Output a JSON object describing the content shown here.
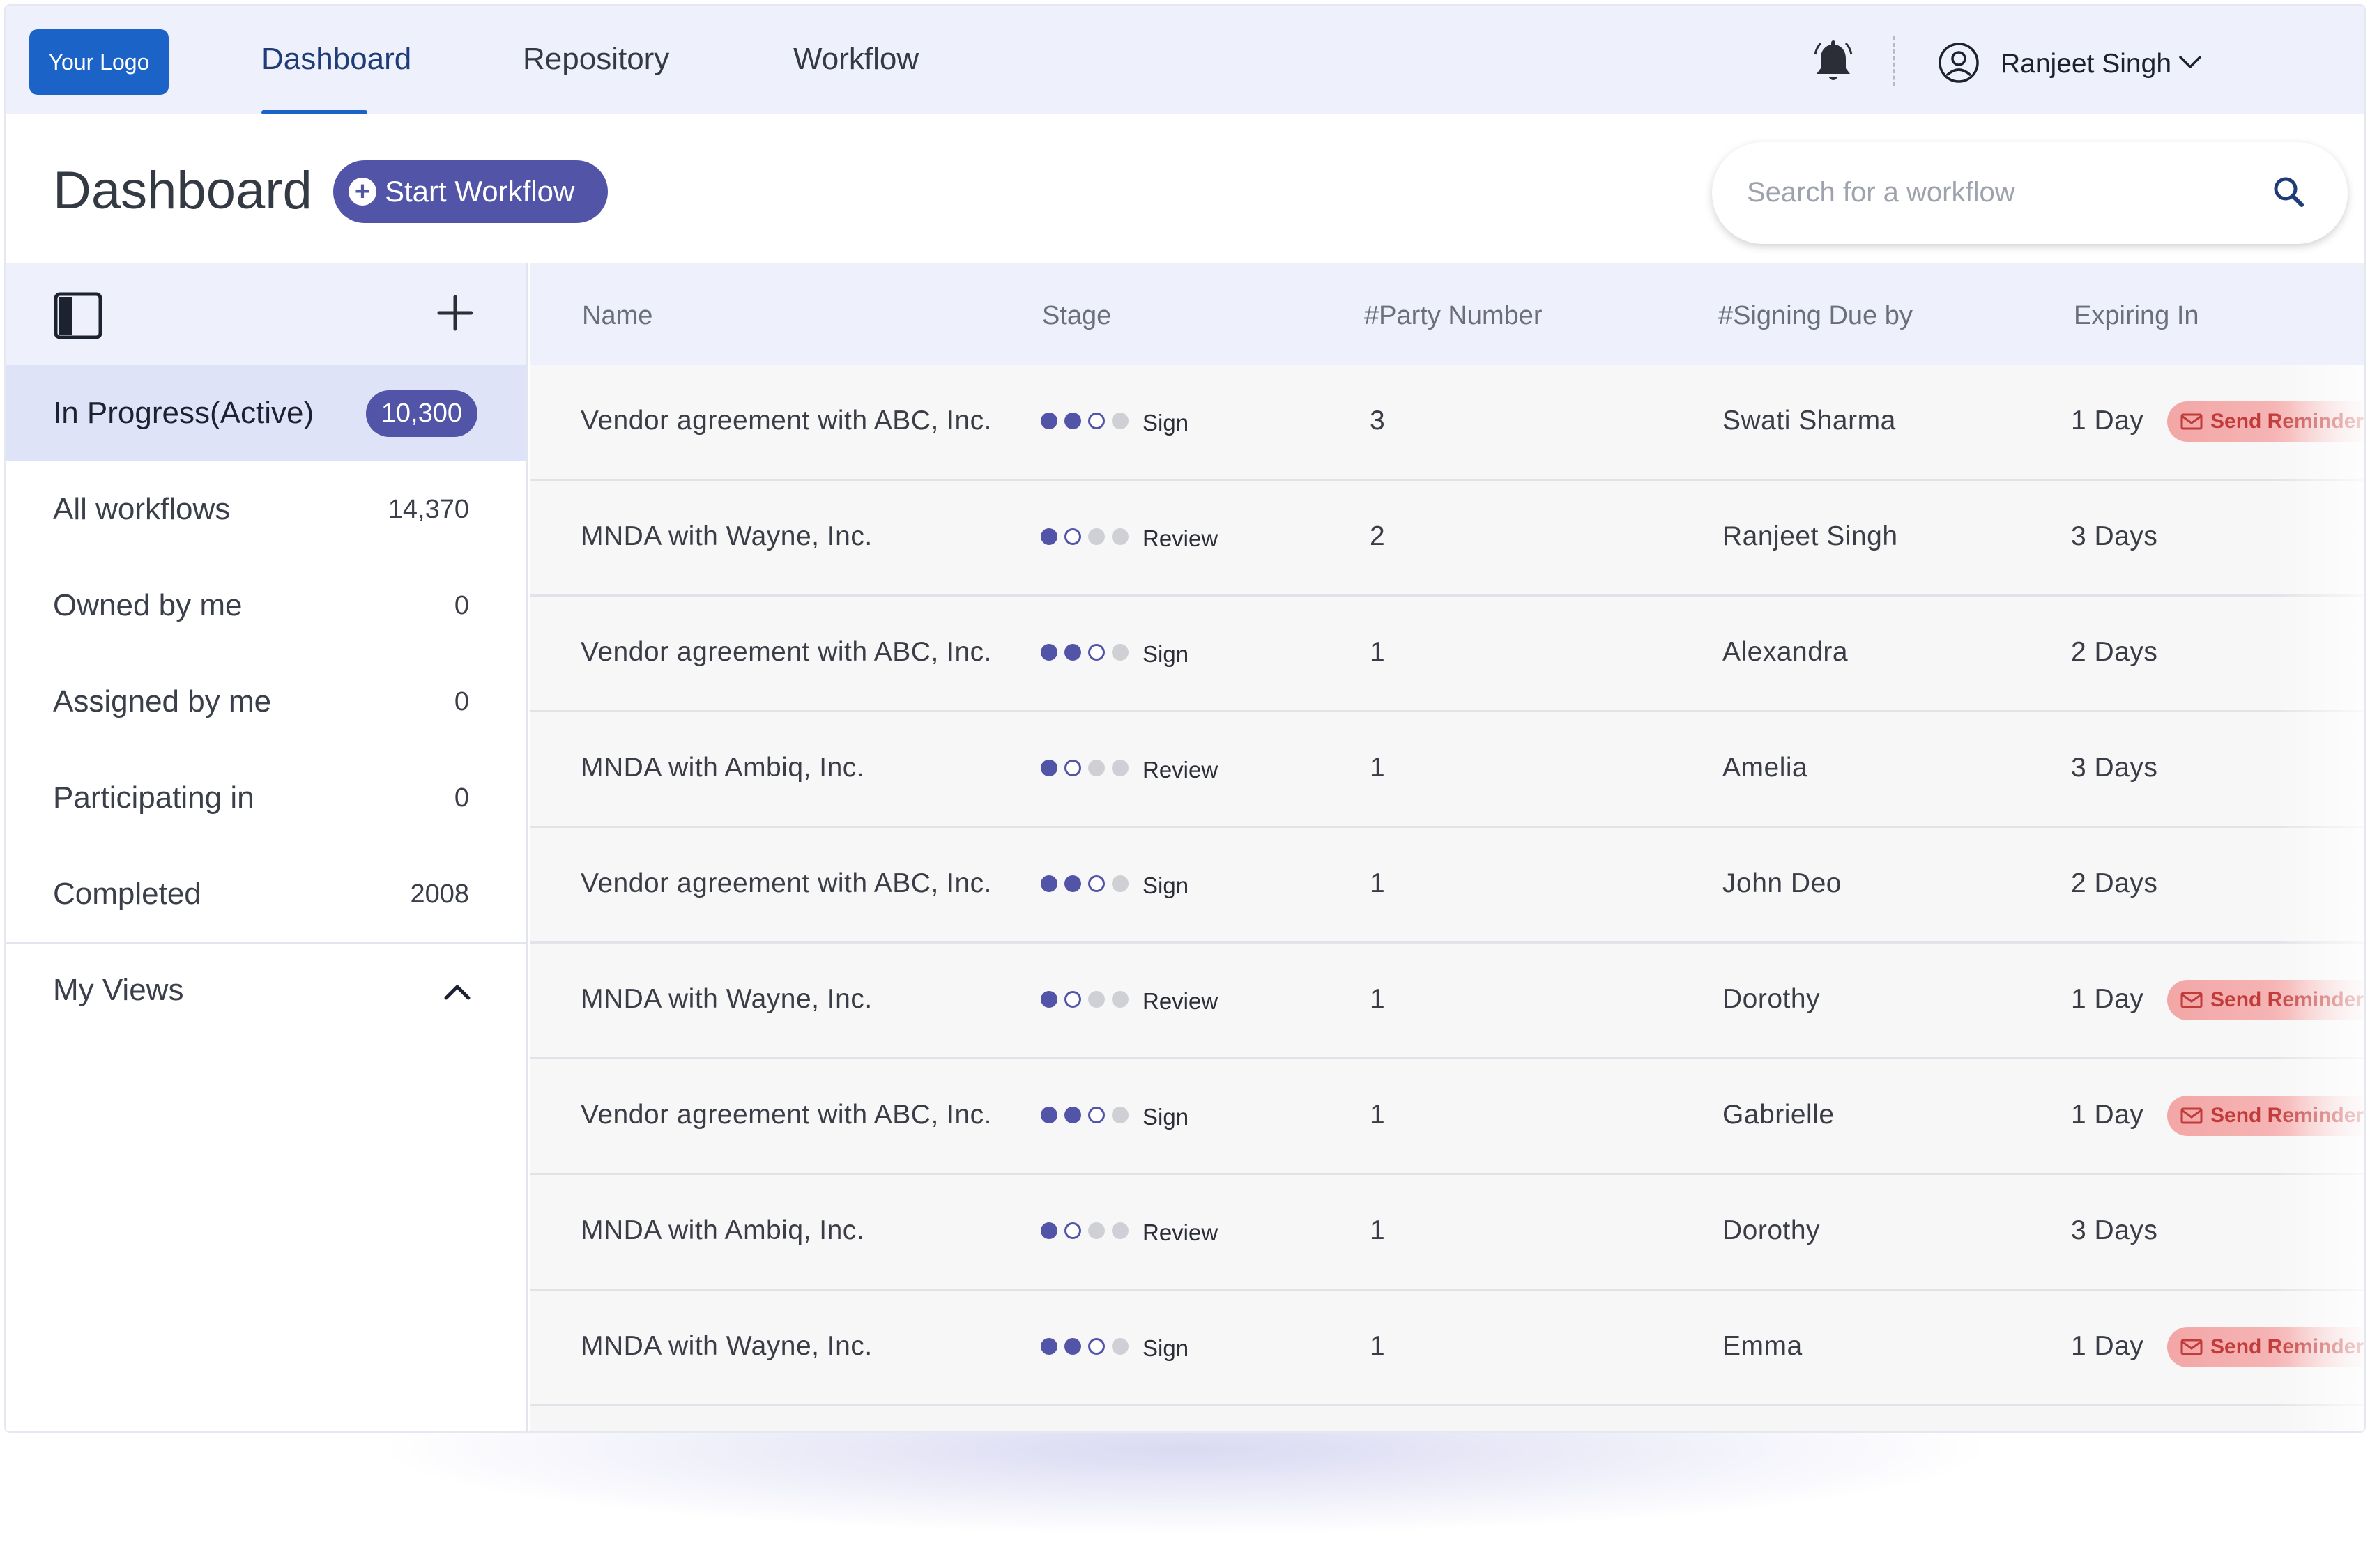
{
  "nav": {
    "logo": "Your Logo",
    "items": [
      "Dashboard",
      "Repository",
      "Workflow"
    ],
    "active": "Dashboard",
    "user_name": "Ranjeet Singh"
  },
  "header": {
    "title": "Dashboard",
    "start_button": "Start Workflow",
    "search_placeholder": "Search for a workflow"
  },
  "sidebar": {
    "items": [
      {
        "label": "In Progress(Active)",
        "count": "10,300",
        "active": true
      },
      {
        "label": "All workflows",
        "count": "14,370"
      },
      {
        "label": "Owned by me",
        "count": "0"
      },
      {
        "label": "Assigned by me",
        "count": "0"
      },
      {
        "label": "Participating in",
        "count": "0"
      },
      {
        "label": "Completed",
        "count": "2008"
      }
    ],
    "views_label": "My Views"
  },
  "table": {
    "columns": [
      "Name",
      "Stage",
      "#Party Number",
      "#Signing Due by",
      "Expiring In"
    ],
    "reminder_label": "Send Reminder",
    "rows": [
      {
        "name": "Vendor agreement with ABC, Inc.",
        "stage": "Sign",
        "dots": [
          "done",
          "done",
          "current",
          "todo"
        ],
        "party": "3",
        "due_by": "Swati Sharma",
        "expiring": "1 Day",
        "reminder": true
      },
      {
        "name": "MNDA with Wayne, Inc.",
        "stage": "Review",
        "dots": [
          "done",
          "current",
          "todo",
          "todo"
        ],
        "party": "2",
        "due_by": "Ranjeet Singh",
        "expiring": "3 Days",
        "reminder": false
      },
      {
        "name": "Vendor agreement with ABC, Inc.",
        "stage": "Sign",
        "dots": [
          "done",
          "done",
          "current",
          "todo"
        ],
        "party": "1",
        "due_by": "Alexandra",
        "expiring": "2 Days",
        "reminder": false
      },
      {
        "name": "MNDA with Ambiq, Inc.",
        "stage": "Review",
        "dots": [
          "done",
          "current",
          "todo",
          "todo"
        ],
        "party": "1",
        "due_by": "Amelia",
        "expiring": "3 Days",
        "reminder": false
      },
      {
        "name": "Vendor agreement with ABC, Inc.",
        "stage": "Sign",
        "dots": [
          "done",
          "done",
          "current",
          "todo"
        ],
        "party": "1",
        "due_by": "John Deo",
        "expiring": "2 Days",
        "reminder": false
      },
      {
        "name": "MNDA with Wayne, Inc.",
        "stage": "Review",
        "dots": [
          "done",
          "current",
          "todo",
          "todo"
        ],
        "party": "1",
        "due_by": "Dorothy",
        "expiring": "1 Day",
        "reminder": true
      },
      {
        "name": "Vendor agreement with ABC, Inc.",
        "stage": "Sign",
        "dots": [
          "done",
          "done",
          "current",
          "todo"
        ],
        "party": "1",
        "due_by": "Gabrielle",
        "expiring": "1 Day",
        "reminder": true
      },
      {
        "name": "MNDA with Ambiq, Inc.",
        "stage": "Review",
        "dots": [
          "done",
          "current",
          "todo",
          "todo"
        ],
        "party": "1",
        "due_by": "Dorothy",
        "expiring": "3 Days",
        "reminder": false
      },
      {
        "name": "MNDA with Wayne, Inc.",
        "stage": "Sign",
        "dots": [
          "done",
          "done",
          "current",
          "todo"
        ],
        "party": "1",
        "due_by": "Emma",
        "expiring": "1 Day",
        "reminder": true
      }
    ]
  },
  "colors": {
    "accent": "#5254a8",
    "brand_blue": "#1c63c8",
    "nav_bg": "#eef0fb",
    "reminder": "#f3a6a6"
  },
  "icons": {
    "bell": "bell-icon",
    "user": "user-circle-icon",
    "chevron": "chevron-down-icon",
    "search": "search-icon",
    "panel": "panel-toggle-icon",
    "add": "plus-icon",
    "mail": "mail-icon"
  }
}
